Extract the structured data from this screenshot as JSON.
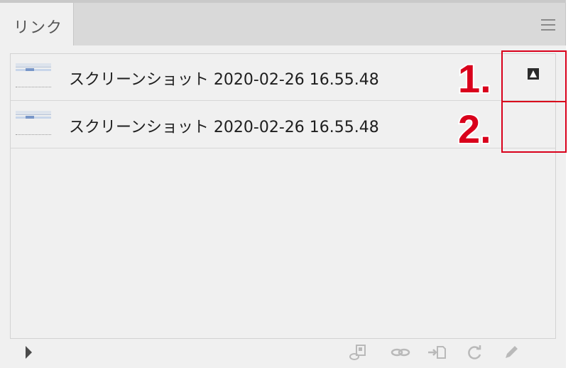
{
  "panel": {
    "tab_label": "リンク"
  },
  "links": [
    {
      "name": "スクリーンショット 2020-02-26 16.55.48",
      "status_icon": "missing-link-icon"
    },
    {
      "name": "スクリーンショット 2020-02-26 16.55.48",
      "status_icon": ""
    }
  ],
  "annotations": {
    "label_1": "1.",
    "label_2": "2.",
    "color": "#d9001b"
  },
  "footer": {
    "icons": [
      "relink-to-libraries-icon",
      "relink-icon",
      "go-to-link-icon",
      "update-link-icon",
      "edit-original-icon"
    ]
  }
}
